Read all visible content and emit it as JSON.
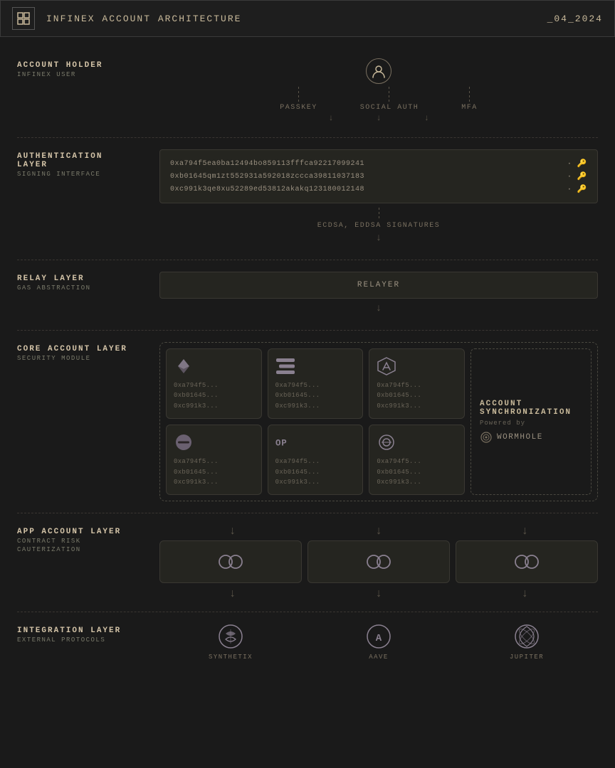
{
  "header": {
    "logo_text": "⊞",
    "title": "INFINEX ACCOUNT ARCHITECTURE",
    "date": "_04_2024"
  },
  "account_holder": {
    "label_main": "ACCOUNT HOLDER",
    "label_sub": "INFINEX USER",
    "auth_methods": [
      "PASSKEY",
      "SOCIAL AUTH",
      "MFA"
    ]
  },
  "auth_layer": {
    "label_main": "AUTHENTICATION",
    "label_sub_1": "LAYER",
    "label_sub_2": "SIGNING INTERFACE",
    "addresses": [
      "0xa794f5ea0ba12494bo859113fffca92217099241",
      "0xb01645qm1zt552931a592018zccca39811037183",
      "0xc991k3qe8xu52289ed53812akakq123180012148"
    ],
    "signature_label": "ECDSA, EDDSA SIGNATURES"
  },
  "relay_layer": {
    "label_main": "RELAY LAYER",
    "label_sub": "GAS ABSTRACTION",
    "relayer_label": "RELAYER"
  },
  "core_layer": {
    "label_main": "CORE ACCOUNT LAYER",
    "label_sub": "SECURITY MODULE",
    "chains": [
      {
        "id": "eth",
        "symbol": "ETH",
        "addrs": [
          "0xa794f5...",
          "0xb01645...",
          "0xc991k3..."
        ]
      },
      {
        "id": "sol",
        "symbol": "SOL",
        "addrs": [
          "0xa794f5...",
          "0xb01645...",
          "0xc991k3..."
        ]
      },
      {
        "id": "arb",
        "symbol": "ARB",
        "addrs": [
          "0xa794f5...",
          "0xb01645...",
          "0xc991k3..."
        ]
      },
      {
        "id": "gnosis",
        "symbol": "GNO",
        "addrs": [
          "0xa794f5...",
          "0xb01645...",
          "0xc991k3..."
        ]
      },
      {
        "id": "op",
        "symbol": "OP",
        "addrs": [
          "0xa794f5...",
          "0xb01645...",
          "0xc991k3..."
        ]
      },
      {
        "id": "poly",
        "symbol": "POLY",
        "addrs": [
          "0xa794f5...",
          "0xb01645...",
          "0xc991k3..."
        ]
      }
    ],
    "sync": {
      "title": "ACCOUNT",
      "title2": "SYNCHRONIZATION",
      "powered_by": "Powered by",
      "wormhole": "WORMHOLE"
    }
  },
  "app_layer": {
    "label_main": "APP ACCOUNT LAYER",
    "label_sub_1": "CONTRACT RISK",
    "label_sub_2": "CAUTERIZATION",
    "items": [
      {
        "icon": "◎"
      },
      {
        "icon": "◎"
      },
      {
        "icon": "◎"
      }
    ]
  },
  "integration_layer": {
    "label_main": "INTEGRATION LAYER",
    "label_sub": "EXTERNAL PROTOCOLS",
    "protocols": [
      {
        "name": "SYNTHETIX",
        "icon": "⇄"
      },
      {
        "name": "AAVE",
        "icon": "Ⓐ"
      },
      {
        "name": "JUPITER",
        "icon": "◎"
      }
    ]
  }
}
